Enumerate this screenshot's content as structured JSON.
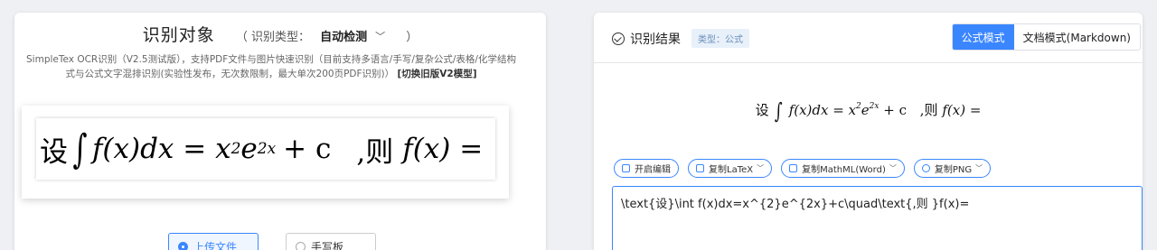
{
  "left": {
    "title": "识别对象",
    "type_label": "（ 识别类型：",
    "type_value": "自动检测",
    "desc_text": "SimpleTex OCR识别（V2.5测试版），支持PDF文件与图片快速识别（目前支持多语言/手写/复杂公式/表格/化学结构式与公式文字混排识别(实验性发布，无次数限制，最大单次200页PDF识别)）",
    "desc_link": "[切换旧版V2模型]",
    "image_formula": {
      "pre": "设",
      "expr_a": "f(x)dx = x",
      "exp1": "2",
      "expr_b": "e",
      "exp2": "2x",
      "expr_c": "+ c",
      "post": ",则",
      "expr_d": "f(x) ="
    },
    "upload_label": "上传文件",
    "handwrite_label": "手写板"
  },
  "right": {
    "title": "识别结果",
    "badge": "类型：公式",
    "mode_formula": "公式模式",
    "mode_doc": "文档模式(Markdown)",
    "rendered": {
      "pre": "设",
      "expr_a": "f(x)dx = x",
      "exp1": "2",
      "expr_b": "e",
      "exp2": "2x",
      "expr_c": "+ c",
      "post": ",则",
      "expr_d": "f(x) ="
    },
    "tools": {
      "edit": "开启编辑",
      "copy_latex": "复制LaTeX",
      "copy_mathml": "复制MathML(Word)",
      "copy_png": "复制PNG"
    },
    "latex_source": "\\text{设}\\int f(x)dx=x^{2}e^{2x}+c\\quad\\text{,则 }f(x)="
  },
  "colors": {
    "accent": "#3a86ff",
    "background": "#eef0f3"
  }
}
